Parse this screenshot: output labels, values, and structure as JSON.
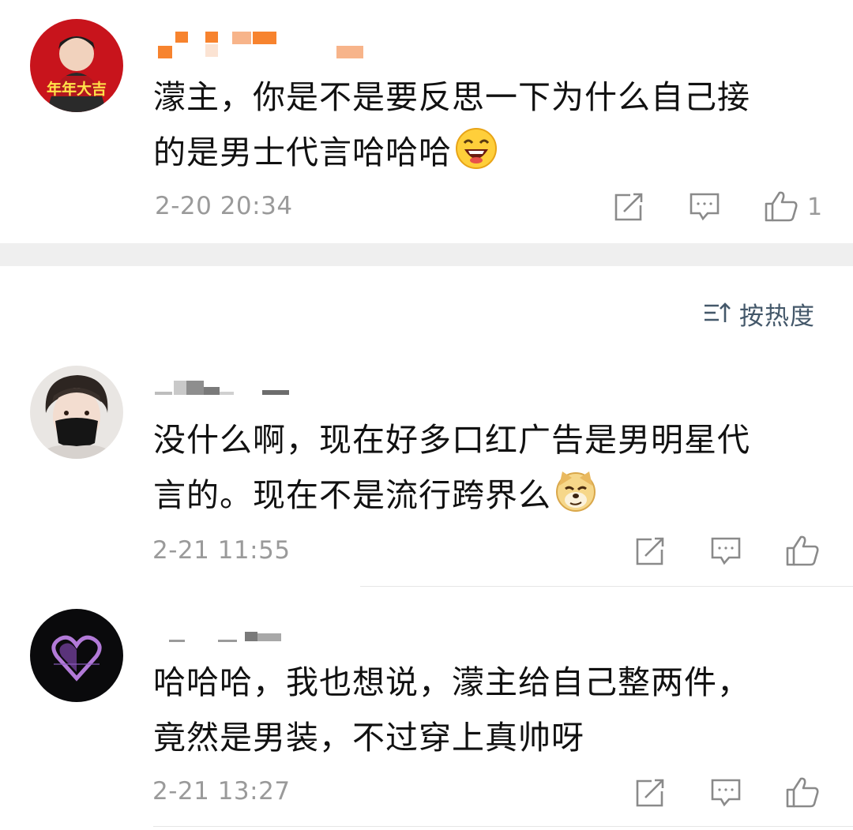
{
  "comments": [
    {
      "avatar_badge": "年年大吉",
      "text_line1": "濛主，你是不是要反思一下为什么自己接",
      "text_line2": "的是男士代言哈哈哈",
      "emoji": "laughing-emoji",
      "time": "2-20 20:34",
      "like_count": "1"
    },
    {
      "text_line1": "没什么啊，现在好多口红广告是男明星代",
      "text_line2": "言的。现在不是流行跨界么",
      "emoji": "doge-emoji",
      "time": "2-21 11:55"
    },
    {
      "text_line1": "哈哈哈，我也想说，濛主给自己整两件，",
      "text_line2": "竟然是男装，不过穿上真帅呀",
      "time": "2-21 13:27"
    }
  ],
  "sort": {
    "label": "按热度"
  },
  "icons": [
    "share-icon",
    "comment-icon",
    "like-icon",
    "sort-icon"
  ],
  "colors": {
    "meta_text": "#9a9a9a",
    "sort_text": "#44586a",
    "separator": "#efefef",
    "blur_orange": "#f7832e"
  }
}
